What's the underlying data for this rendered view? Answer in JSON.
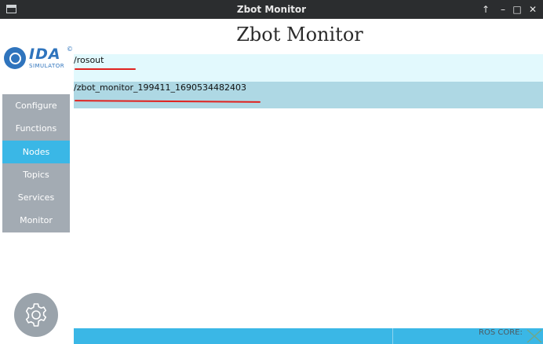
{
  "window": {
    "title": "Zbot Monitor"
  },
  "logo": {
    "brand": "IDA",
    "registered": "©",
    "subtitle": "SIMULATOR"
  },
  "page": {
    "title": "Zbot Monitor"
  },
  "sidebar": {
    "items": [
      {
        "label": "Configure",
        "active": false
      },
      {
        "label": "Functions",
        "active": false
      },
      {
        "label": "Nodes",
        "active": true
      },
      {
        "label": "Topics",
        "active": false
      },
      {
        "label": "Services",
        "active": false
      },
      {
        "label": "Monitor",
        "active": false
      }
    ]
  },
  "nodes": {
    "rows": [
      {
        "name": "/rosout"
      },
      {
        "name": "/zbot_monitor_199411_1690534482403"
      }
    ]
  },
  "status": {
    "ros_core_label": "ROS CORE:"
  },
  "colors": {
    "accent": "#3ab7e6",
    "sidebar_bg": "#a3abb3",
    "row_light": "#e2f9fd",
    "row_selected": "#aed8e4",
    "annotation_red": "#e0221f",
    "titlebar": "#2b2d2f"
  }
}
